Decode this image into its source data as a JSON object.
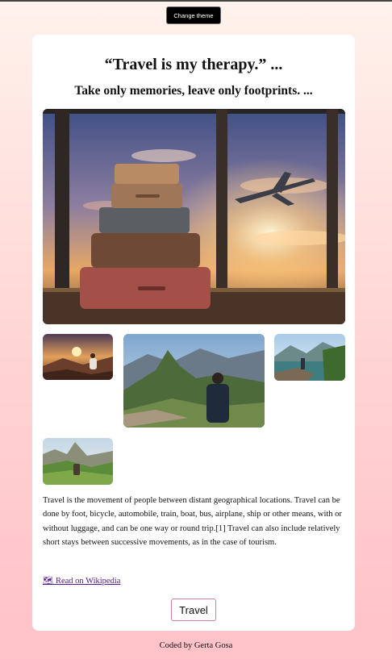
{
  "header": {
    "theme_button_label": "Change theme"
  },
  "card": {
    "title": "“Travel is my therapy.” ...",
    "subtitle": "Take only memories, leave only footprints. ...",
    "images": [
      {
        "name": "hero-suitcases-airplane"
      },
      {
        "name": "gallery-sunset-hiker"
      },
      {
        "name": "gallery-machu-picchu"
      },
      {
        "name": "gallery-lake-traveler"
      },
      {
        "name": "gallery-mountain-valley"
      }
    ],
    "description": "Travel is the movement of people between distant geographical locations. Travel can be done by foot, bicycle, automobile, train, boat, bus, airplane, ship or other means, with or without luggage, and can be one way or round trip.[1] Travel can also include relatively short stays between successive movements, as in the case of tourism.",
    "wiki_link_label": "🗺 Read on Wikipedia",
    "travel_button_label": "Travel"
  },
  "footer": {
    "credit": "Coded by Gerta Gosa"
  },
  "colors": {
    "card_bg": "#ffffff",
    "button_border": "#d87ba8",
    "link": "#551a8b",
    "theme_button_bg": "#000000"
  }
}
